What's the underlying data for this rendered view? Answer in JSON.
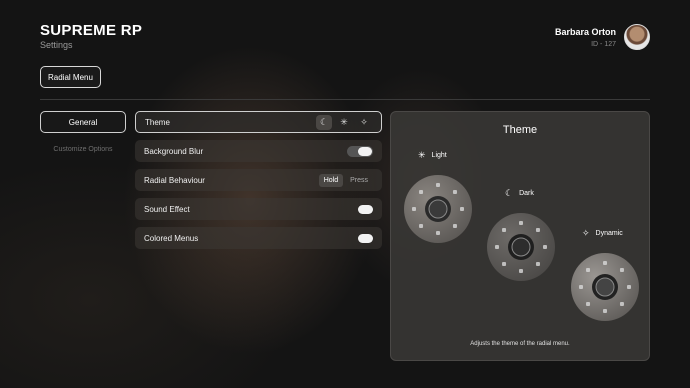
{
  "header": {
    "title": "SUPREME RP",
    "subtitle": "Settings",
    "user_name": "Barbara Orton",
    "user_id": "ID - 127"
  },
  "section_button": "Radial Menu",
  "nav": {
    "general": "General",
    "customize": "Customize Options"
  },
  "settings": {
    "theme": {
      "label": "Theme",
      "options": [
        "moon-icon",
        "sun-icon",
        "sparkle-icon"
      ],
      "active": "moon-icon"
    },
    "background_blur": {
      "label": "Background Blur",
      "enabled": true
    },
    "radial_behaviour": {
      "label": "Radial Behaviour",
      "options": [
        "Hold",
        "Press"
      ],
      "selected": "Hold"
    },
    "sound_effect": {
      "label": "Sound Effect",
      "enabled": true
    },
    "colored_menus": {
      "label": "Colored Menus",
      "enabled": true
    }
  },
  "preview": {
    "title": "Theme",
    "caption": "Adjusts the theme of the radial menu.",
    "variants": {
      "light": "Light",
      "dark": "Dark",
      "dynamic": "Dynamic"
    }
  }
}
